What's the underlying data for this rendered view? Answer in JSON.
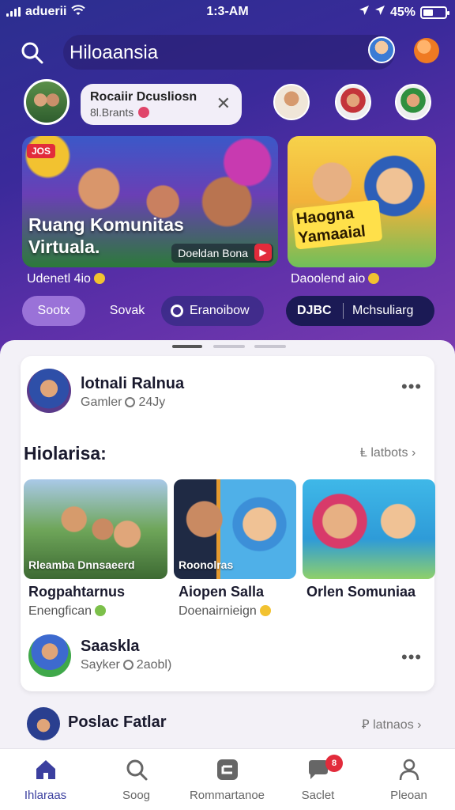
{
  "status_bar": {
    "carrier": "aduerii",
    "time": "1:3-AM",
    "battery_text": "45%",
    "battery_level": 0.45
  },
  "search": {
    "value": "Hiloaansia"
  },
  "chip": {
    "title": "Rocaiir Dcusliosn",
    "subtitle": "8l.Brants"
  },
  "banners": [
    {
      "badge": "JOS",
      "title": "Ruang Komunitas Virtuala.",
      "tag": "Doeldan Bona",
      "caption": "Udenetl 4io"
    },
    {
      "title": "Haogna Yamaaial",
      "caption": "Daoolend aio"
    }
  ],
  "filters": {
    "pill_1": "Sootx",
    "pill_2": "Sovak",
    "pill_3": "Eranoibow",
    "pill_4a": "DJBC",
    "pill_4b": "Mchsuliarg"
  },
  "post": {
    "name": "lotnali Ralnua",
    "meta_left": "Gamler",
    "meta_right": "24Jy"
  },
  "section": {
    "title": "Hiolarisa:",
    "link": "Ⱡ latbots"
  },
  "items": [
    {
      "thumb_label": "Rleamba Dnnsaeerd",
      "title": "Rogpahtarnus",
      "sub": "Enengfican"
    },
    {
      "thumb_label": "Roonolras",
      "title": "Aiopen Salla",
      "sub": "Doenairnieign"
    },
    {
      "thumb_label": "",
      "title": "Orlen Somuniaa",
      "sub": ""
    }
  ],
  "user": {
    "name": "Saaskla",
    "meta_left": "Sayker",
    "meta_right": "2aobl)"
  },
  "next_section": {
    "title": "Poslac Fatlar",
    "link": "Ꝑ latnaos"
  },
  "tabbar": {
    "tabs": [
      {
        "label": "Ihlaraas",
        "icon": "home-icon"
      },
      {
        "label": "Soog",
        "icon": "search-icon"
      },
      {
        "label": "Rommartanoe",
        "icon": "community-icon"
      },
      {
        "label": "Saclet",
        "icon": "chat-icon"
      },
      {
        "label": "Pleoan",
        "icon": "profile-icon"
      }
    ],
    "badge": "8"
  },
  "colors": {
    "accent": "#3b3f9f",
    "header_gradient_start": "#2b2f8f",
    "header_gradient_end": "#7a3bb0",
    "live_red": "#e22b3b"
  }
}
